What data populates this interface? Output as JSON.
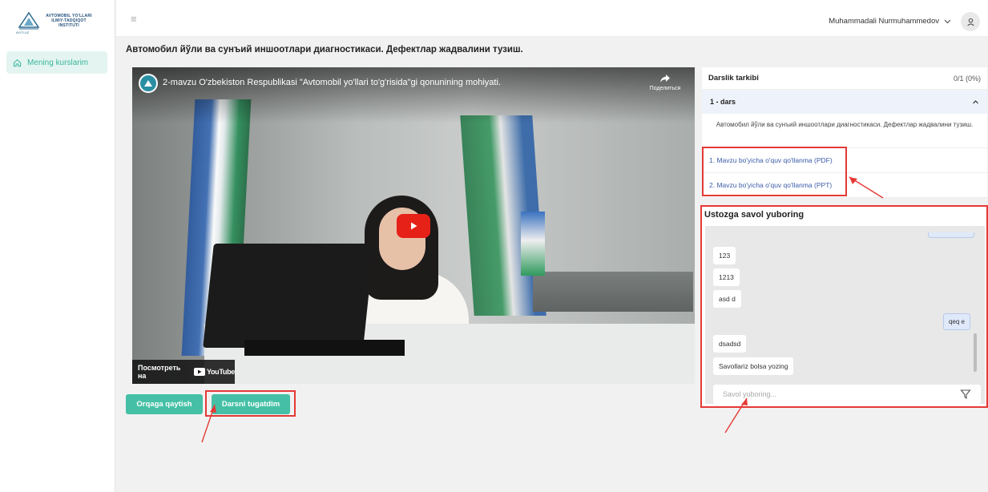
{
  "logo": {
    "line1": "AVTOMOBIL YO'LLARI",
    "line2": "ILMIY-TADQIQOT",
    "line3": "INSTITUTI",
    "caption": "AYITI.UZ"
  },
  "sidebar": {
    "items": [
      {
        "label": "Mening kurslarim",
        "icon": "home-icon"
      }
    ]
  },
  "header": {
    "user_name": "Muhammadali Nurmuhammedov"
  },
  "page": {
    "title": "Автомобил йўли ва сунъий иншоотлари диагностикаси. Дефектлар жадвалини тузиш."
  },
  "video": {
    "title": "2-mavzu O'zbekiston Respublikasi \"Avtomobil yo'llari to'g'risida\"gi qonunining mohiyati.",
    "share_label": "Поделиться",
    "watch_on": "Посмотреть на",
    "yt_name": "YouTube"
  },
  "actions": {
    "back_label": "Orqaga qaytish",
    "done_label": "Darsni tugatdim"
  },
  "lesson_panel": {
    "title": "Darslik tarkibi",
    "progress": "0/1 (0%)",
    "lesson_label": "1 - dars",
    "lesson_description": "Автомобил йўли ва сунъий иншоотлари диагностикаси. Дефектлар жадвалини тузиш.",
    "resources": [
      "1. Mavzu bo'yicha o'quv qo'llanma (PDF)",
      "2. Mavzu bo'yicha o'quv qo'llanma (PPT)"
    ]
  },
  "chat": {
    "title": "Ustozga savol yuboring",
    "messages": [
      "123",
      "1213",
      "asd d",
      "qeq e",
      "dsadsd",
      "Savollariz bolsa yozing"
    ],
    "input_placeholder": "Savol yuboring..."
  },
  "colors": {
    "accent": "#45c0a6",
    "highlight": "#e53935",
    "link": "#3b5ba8"
  }
}
